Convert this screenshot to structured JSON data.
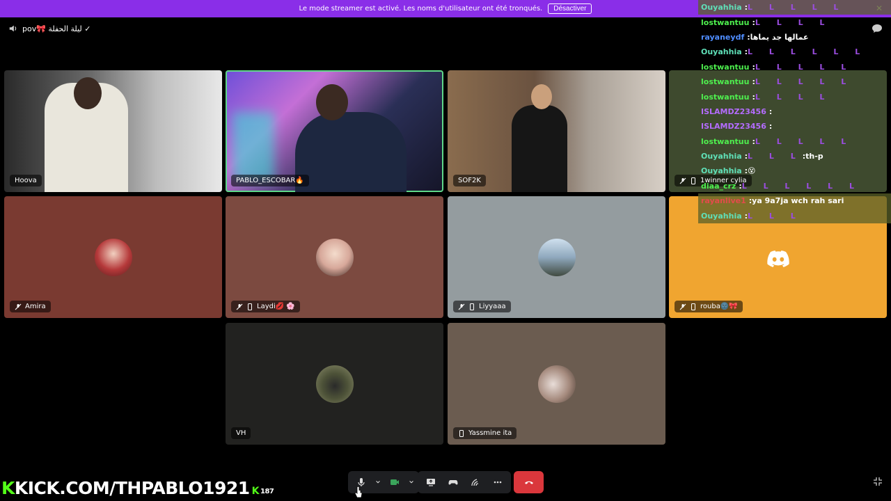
{
  "banner": {
    "text": "Le mode streamer est activé. Les noms d'utilisateur ont été tronqués.",
    "button": "Désactiver"
  },
  "channel": {
    "name": "pov🎀 ليلة الحفلة ✓"
  },
  "tiles": [
    {
      "name": "Hoova",
      "kind": "video"
    },
    {
      "name": "PABLO_ESCOBAR🔥",
      "kind": "video",
      "speaking": true
    },
    {
      "name": "SOF2K",
      "kind": "video"
    },
    {
      "name": "1winner cylia",
      "kind": "video",
      "muted": true,
      "mobile": true
    },
    {
      "name": "Amira",
      "kind": "avatar",
      "muted": true
    },
    {
      "name": "Laydi💋 🌸",
      "kind": "avatar",
      "muted": true,
      "mobile": true
    },
    {
      "name": "Liyyaaa",
      "kind": "avatar",
      "muted": true,
      "mobile": true
    },
    {
      "name": "rouba🌚🎀",
      "kind": "discord",
      "muted": true,
      "mobile": true
    },
    {
      "name": "VH",
      "kind": "avatar"
    },
    {
      "name": "Yassmine ita",
      "kind": "avatar",
      "mobile": true
    }
  ],
  "chat": {
    "lines": [
      {
        "user": "Ouyahhia",
        "color": "#5fe0b8",
        "msg": "",
        "emotes": "L L L L L",
        "hl": true
      },
      {
        "user": "lostwantuu",
        "color": "#4ef04e",
        "msg": "",
        "emotes": "L L L L"
      },
      {
        "user": "rayaneydf",
        "color": "#4f8dff",
        "msg": "عمالها جد يماها"
      },
      {
        "user": "Ouyahhia",
        "color": "#5fe0b8",
        "msg": "",
        "emotes": "L L L L L L"
      },
      {
        "user": "lostwantuu",
        "color": "#4ef04e",
        "msg": "",
        "emotes": "L L L L L"
      },
      {
        "user": "lostwantuu",
        "color": "#4ef04e",
        "msg": "",
        "emotes": "L L L L L"
      },
      {
        "user": "lostwantuu",
        "color": "#4ef04e",
        "msg": "",
        "emotes": "L L L L"
      },
      {
        "user": "ISLAMDZ23456",
        "color": "#b46cff",
        "msg": ""
      },
      {
        "user": "ISLAMDZ23456",
        "color": "#b46cff",
        "msg": ""
      },
      {
        "user": "lostwantuu",
        "color": "#4ef04e",
        "msg": "",
        "emotes": "L L L L L"
      },
      {
        "user": "Ouyahhia",
        "color": "#5fe0b8",
        "msg": ":th-p",
        "emotes": "L L L"
      },
      {
        "user": "Ouyahhia",
        "color": "#5fe0b8",
        "msg": "😵"
      },
      {
        "user": "diaa_crz",
        "color": "#4ef04e",
        "msg": "",
        "emotes": "L L L L L L"
      },
      {
        "user": "rayanlive1",
        "color": "#e34b4b",
        "msg": "ya 9a7ja wch rah sari",
        "hl": true
      },
      {
        "user": "Ouyahhia",
        "color": "#5fe0b8",
        "msg": "",
        "emotes": "L L L",
        "hl": true
      }
    ]
  },
  "stream": {
    "url": "KICK.COM/THPABLO1921",
    "viewers": "187"
  },
  "colors": {
    "accent": "#8a2ee8",
    "kick": "#53fc18",
    "end_call": "#da373c",
    "speaking": "#5fd889"
  }
}
